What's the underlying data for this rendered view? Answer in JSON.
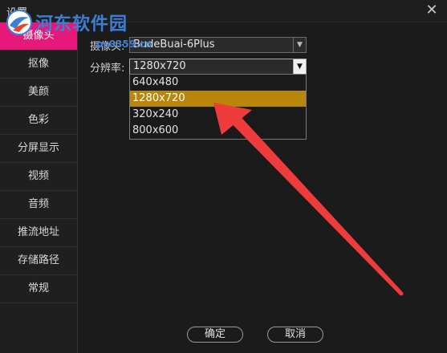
{
  "window": {
    "title": "设置",
    "close_glyph": "✕"
  },
  "watermark": {
    "name": "河东软件园",
    "url": "pc0359.cn"
  },
  "sidebar": {
    "items": [
      {
        "label": "摄像头",
        "active": true
      },
      {
        "label": "抠像",
        "active": false
      },
      {
        "label": "美颜",
        "active": false
      },
      {
        "label": "色彩",
        "active": false
      },
      {
        "label": "分屏显示",
        "active": false
      },
      {
        "label": "视频",
        "active": false
      },
      {
        "label": "音频",
        "active": false
      },
      {
        "label": "推流地址",
        "active": false
      },
      {
        "label": "存储路径",
        "active": false
      },
      {
        "label": "常规",
        "active": false
      }
    ]
  },
  "camera": {
    "label": "摄像头:",
    "value": "BudeBuai-6Plus"
  },
  "resolution": {
    "label": "分辨率:",
    "value": "1280x720",
    "options": [
      {
        "label": "640x480",
        "highlighted": false
      },
      {
        "label": "1280x720",
        "highlighted": true
      },
      {
        "label": "320x240",
        "highlighted": false
      },
      {
        "label": "800x600",
        "highlighted": false
      }
    ]
  },
  "buttons": {
    "ok": "确定",
    "cancel": "取消"
  },
  "colors": {
    "active_tab": "#e6197a",
    "highlight": "#b8860b",
    "annotation_arrow": "#ee3b3b",
    "watermark": "#3d7fd6"
  }
}
